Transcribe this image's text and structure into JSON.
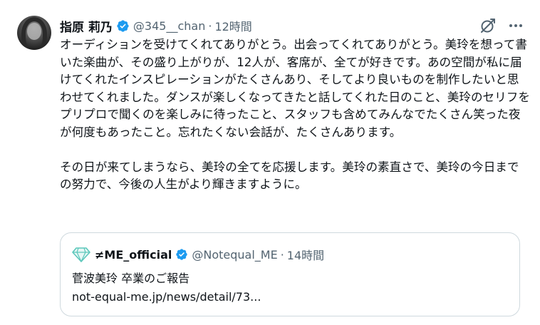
{
  "author": {
    "name": "指原 莉乃",
    "handle": "@345__chan",
    "separator": "·",
    "time": "12時間"
  },
  "tweet": {
    "paragraph1": "オーディションを受けてくれてありがとう。出会ってくれてありがとう。美玲を想って書いた楽曲が、その盛り上がりが、12人が、客席が、全てが好きです。あの空間が私に届けてくれたインスピレーションがたくさんあり、そしてより良いものを制作したいと思わせてくれました。ダンスが楽しくなってきたと話してくれた日のこと、美玲のセリフをプリプロで聞くのを楽しみに待ったこと、スタッフも含めてみんなでたくさん笑った夜が何度もあったこと。忘れたくない会話が、たくさんあります。",
    "paragraph2": "その日が来てしまうなら、美玲の全てを応援します。美玲の素直さで、美玲の今日までの努力で、今後の人生がより輝きますように。"
  },
  "quote": {
    "name": "≠ME_official",
    "handle": "@Notequal_ME",
    "separator": "·",
    "time": "14時間",
    "text": "菅波美玲 卒業のご報告",
    "link": "not-equal-me.jp/news/detail/73..."
  },
  "icons": {
    "verified": "verified-badge-icon",
    "grok": "grok-icon",
    "more": "more-icon",
    "quote_logo": "diamond-logo-icon"
  },
  "colors": {
    "verified": "#1d9bf0",
    "secondary_text": "#536471",
    "border": "#cfd9de"
  }
}
